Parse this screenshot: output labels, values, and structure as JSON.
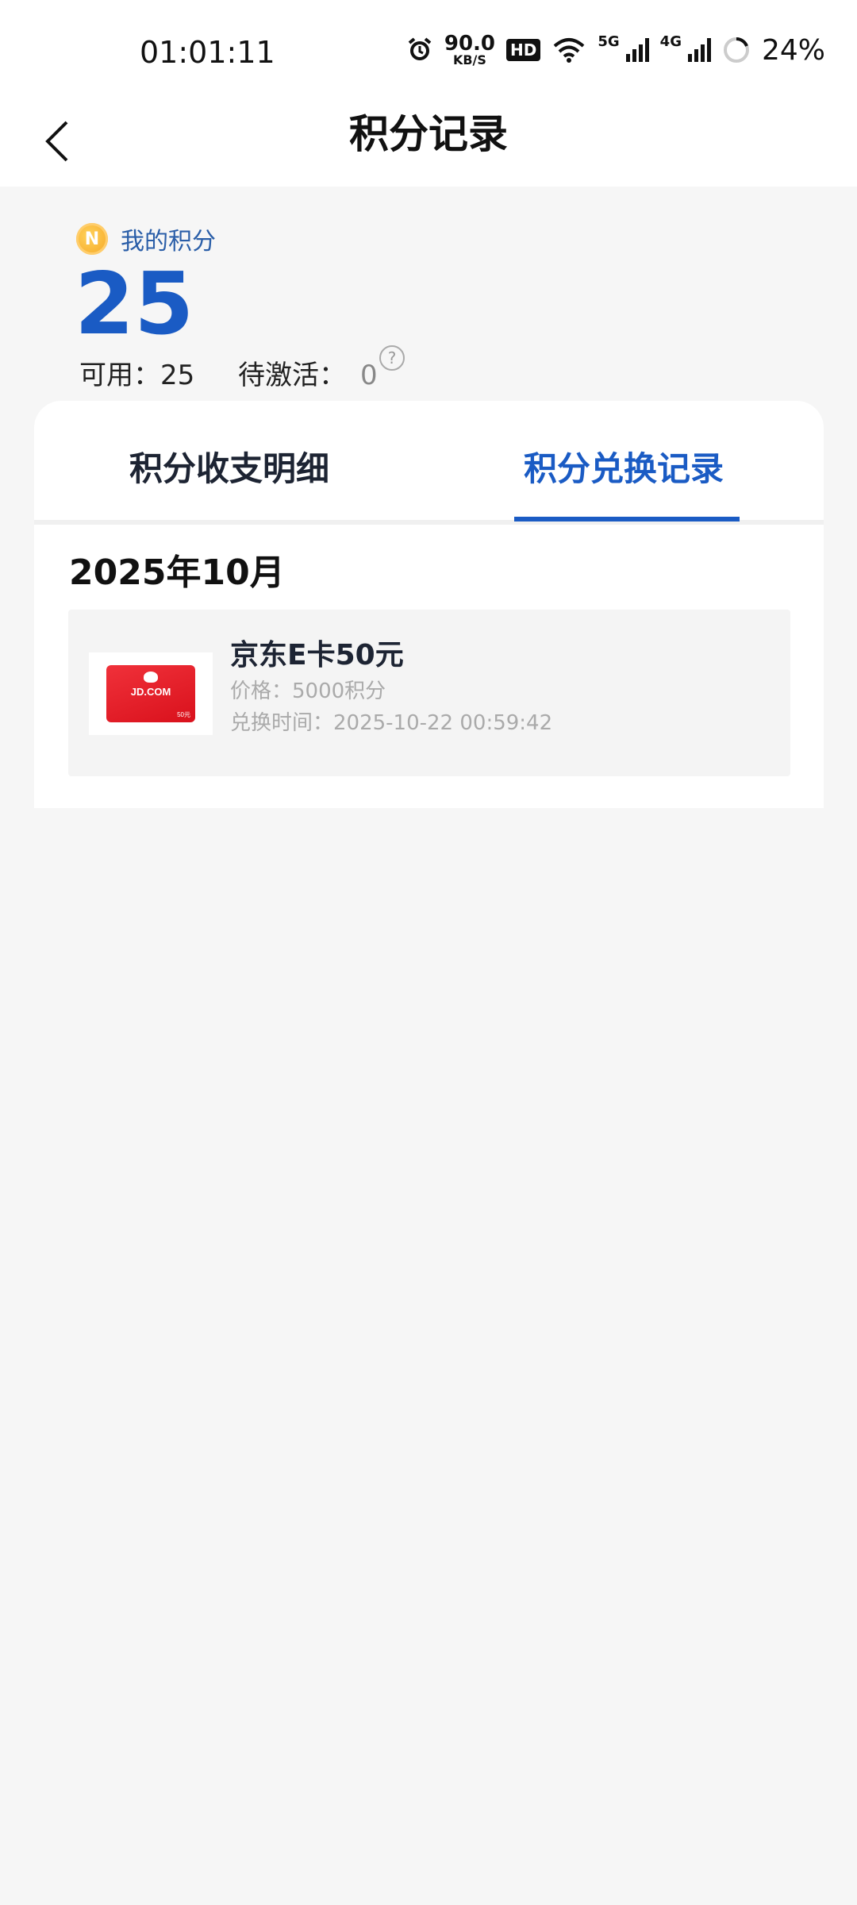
{
  "status_bar": {
    "time": "01:01:11",
    "net_speed_value": "90.0",
    "net_speed_unit": "KB/S",
    "hd_label": "HD",
    "signal1_label": "5G",
    "signal2_label": "4G",
    "battery_percent": "24%",
    "icons": [
      "alarm-icon",
      "hd-icon",
      "wifi-icon",
      "signal-5g-icon",
      "signal-4g-icon",
      "battery-ring-icon"
    ]
  },
  "header": {
    "title": "积分记录",
    "back_icon": "chevron-left-icon"
  },
  "points": {
    "coin_icon": "coin-icon",
    "coin_letter": "N",
    "label": "我的积分",
    "value": "25",
    "available_text": "可用：25",
    "pending_label": "待激活：",
    "pending_value": "0",
    "help_icon": "?"
  },
  "tabs": [
    {
      "label": "积分收支明细",
      "active": false
    },
    {
      "label": "积分兑换记录",
      "active": true
    }
  ],
  "records": {
    "month": "2025年10月",
    "items": [
      {
        "title": "京东E卡50元",
        "price": "价格：5000积分",
        "time": "兑换时间：2025-10-22 00:59:42",
        "thumb_logo": "JD.COM",
        "thumb_small_text": "50元"
      }
    ]
  },
  "colors": {
    "accent_blue": "#1a5bc4",
    "coin_orange": "#f5a623",
    "jd_red": "#e02a32",
    "background": "#f6f6f6"
  }
}
